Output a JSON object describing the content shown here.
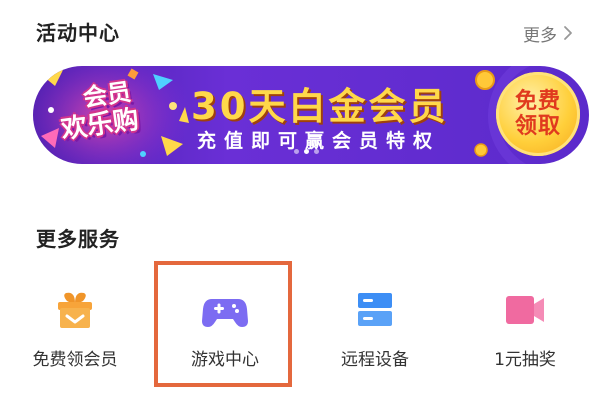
{
  "activity": {
    "title": "活动中心",
    "more_label": "更多"
  },
  "banner": {
    "badge_line_1": "会员",
    "badge_line_2": "欢乐购",
    "headline": "30天白金会员",
    "subline": "充值即可赢会员特权",
    "button_line_1": "免费",
    "button_line_2": "领取",
    "active_slide": 2,
    "slide_count": 3
  },
  "services": {
    "title": "更多服务",
    "items": [
      {
        "label": "免费领会员",
        "icon": "gift-box-icon",
        "color": "#f7a43a"
      },
      {
        "label": "游戏中心",
        "icon": "gamepad-icon",
        "color": "#7c6cf2"
      },
      {
        "label": "远程设备",
        "icon": "remote-device-icon",
        "color": "#3d8ef5"
      },
      {
        "label": "1元抽奖",
        "icon": "video-camera-icon",
        "color": "#f06aa0"
      }
    ],
    "highlighted_item": "游戏中心"
  },
  "colors": {
    "banner_bg": "#6a2fd6",
    "headline": "#ffd84a",
    "highlight_border": "#e4683d"
  }
}
